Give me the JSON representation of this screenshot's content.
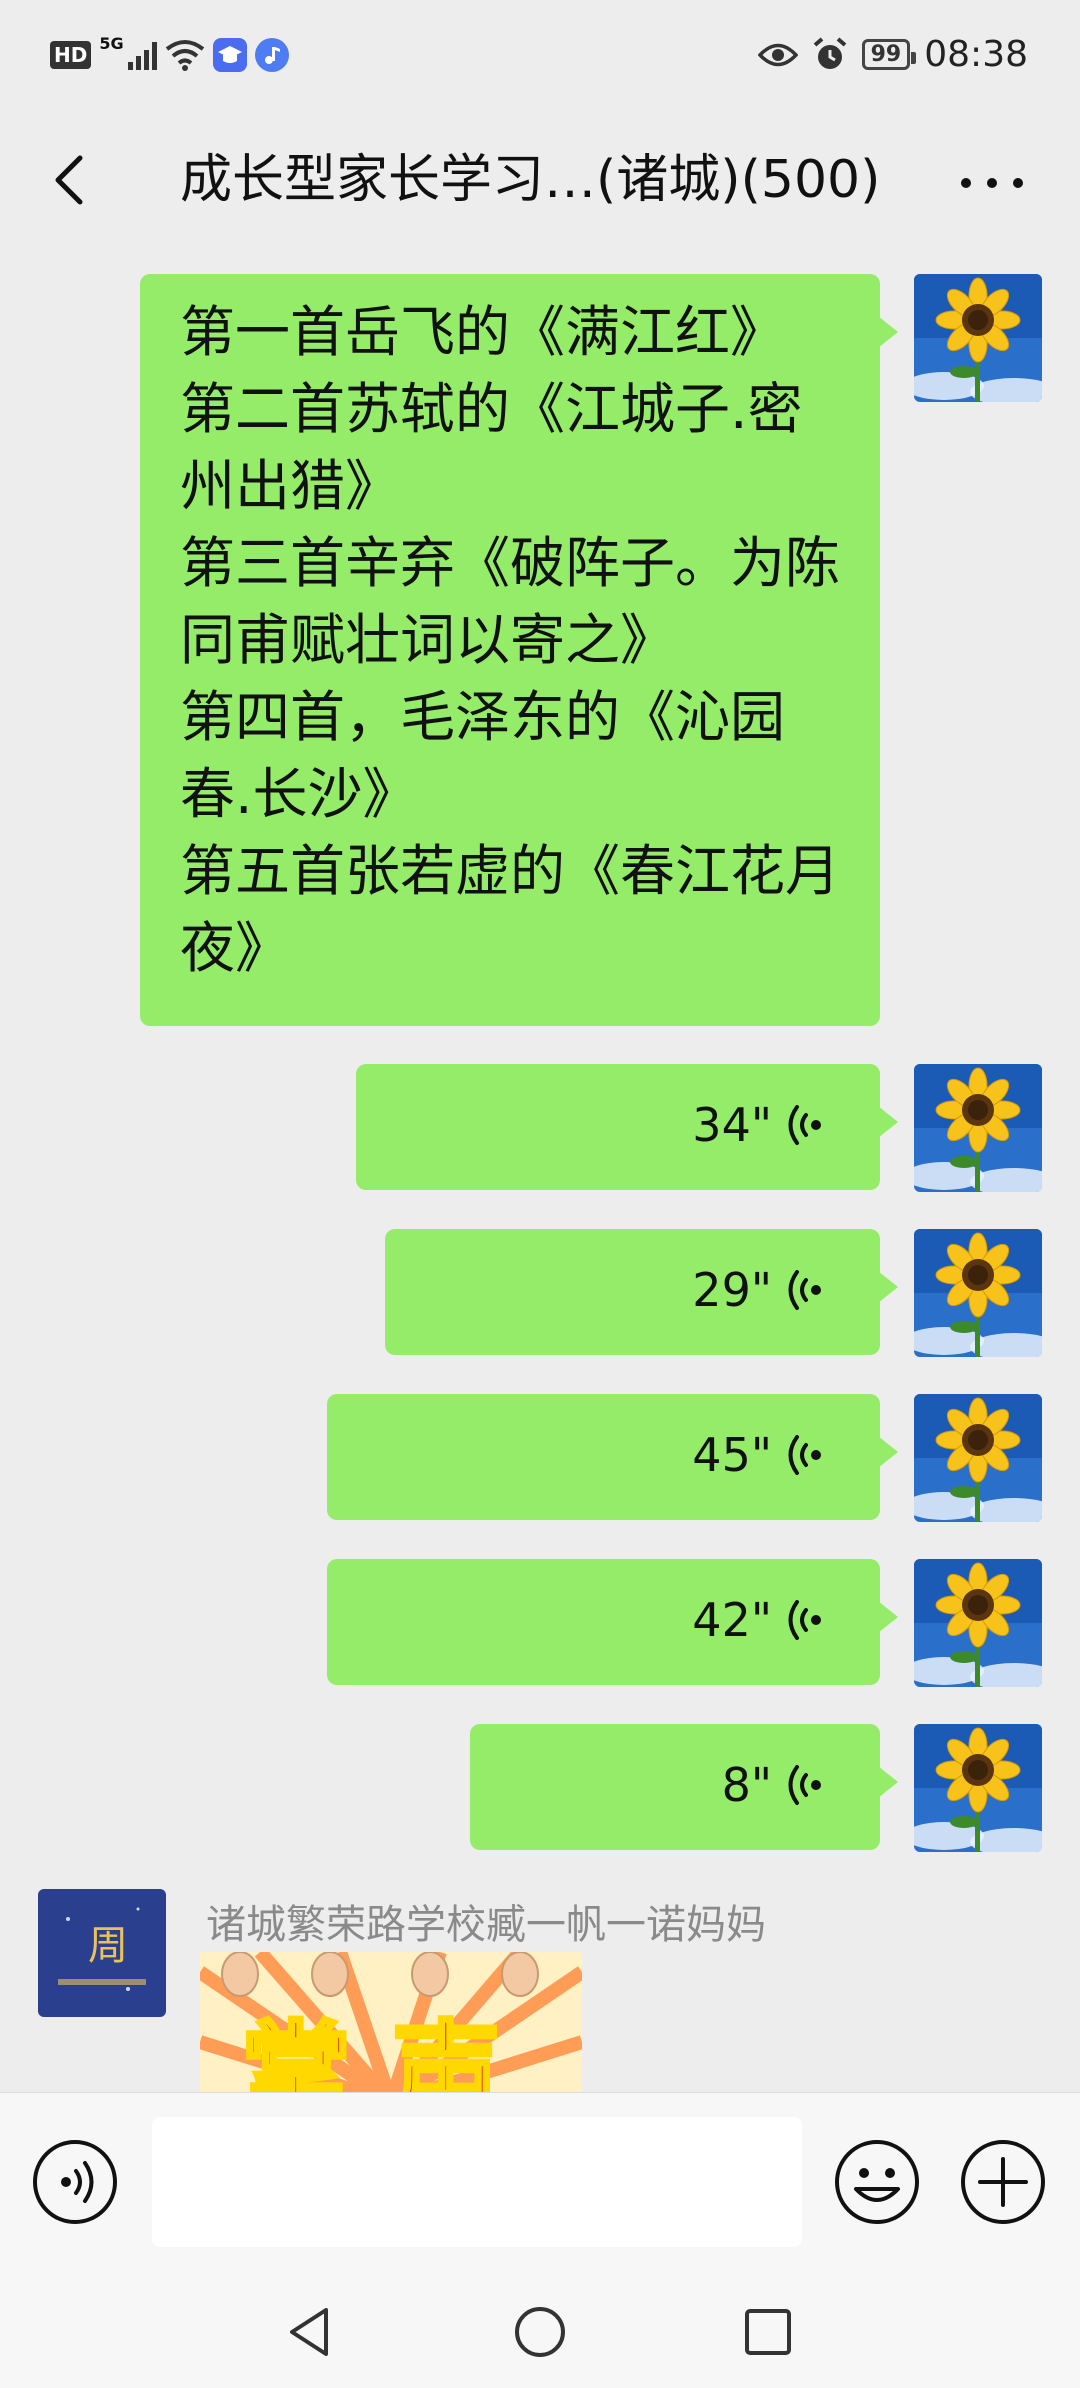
{
  "status_bar": {
    "network_badge": "HD",
    "network_type": "5G",
    "battery": "99",
    "time": "08:38"
  },
  "header": {
    "title": "成长型家长学习…(诸城)(500)"
  },
  "messages": {
    "text_message": "第一首岳飞的《满江红》\n第二首苏轼的《江城子.密州出猎》\n第三首辛弃《破阵子。为陈同甫赋壮词以寄之》\n第四首，毛泽东的《沁园春.长沙》\n第五首张若虚的《春江花月夜》",
    "voice": [
      {
        "duration": "34\""
      },
      {
        "duration": "29\""
      },
      {
        "duration": "45\""
      },
      {
        "duration": "42\""
      },
      {
        "duration": "8\""
      }
    ],
    "other_sender": "诸城繁荣路学校臧一帆一诺妈妈",
    "sticker_text": "掌声"
  },
  "input": {
    "value": ""
  },
  "colors": {
    "bubble": "#95ec69",
    "background": "#ededed"
  },
  "icons": [
    "back-icon",
    "more-icon",
    "voice-mode-icon",
    "emoji-icon",
    "plus-icon",
    "nav-back-icon",
    "nav-home-icon",
    "nav-recents-icon",
    "eye-icon",
    "alarm-icon",
    "wifi-icon"
  ]
}
